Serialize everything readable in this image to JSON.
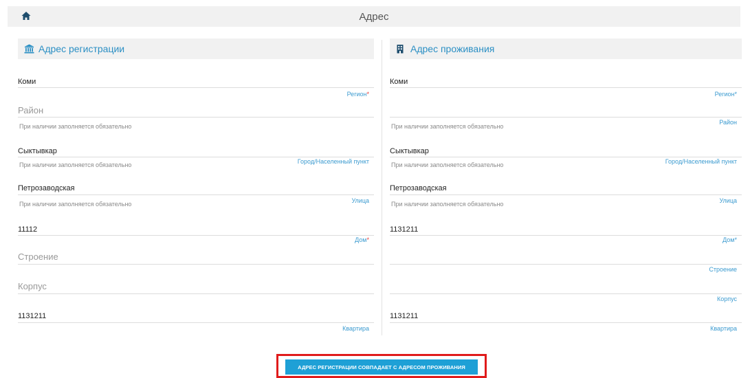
{
  "header": {
    "title": "Адрес"
  },
  "registration": {
    "title": "Адрес регистрации",
    "region": {
      "value": "Коми",
      "label": "Регион",
      "required": "*"
    },
    "district": {
      "placeholder": "Район",
      "hint": "При наличии заполняется обязательно"
    },
    "city": {
      "value": "Сыктывкар",
      "label": "Город/Населенный пункт",
      "hint": "При наличии заполняется обязательно"
    },
    "street": {
      "value": "Петрозаводская",
      "label": "Улица",
      "hint": "При наличии заполняется обязательно"
    },
    "house": {
      "value": "11112",
      "label": "Дом",
      "required": "*"
    },
    "building": {
      "placeholder": "Строение"
    },
    "block": {
      "placeholder": "Корпус"
    },
    "apartment": {
      "value": "1131211",
      "label": "Квартира"
    }
  },
  "residence": {
    "title": "Адрес проживания",
    "region": {
      "value": "Коми",
      "label": "Регион*"
    },
    "district": {
      "label": "Район",
      "hint": "При наличии заполняется обязательно"
    },
    "city": {
      "value": "Сыктывкар",
      "label": "Город/Населенный пункт",
      "hint": "При наличии заполняется обязательно"
    },
    "street": {
      "value": "Петрозаводская",
      "label": "Улица",
      "hint": "При наличии заполняется обязательно"
    },
    "house": {
      "value": "1131211",
      "label": "Дом*"
    },
    "building": {
      "label": "Строение"
    },
    "block": {
      "label": "Корпус"
    },
    "apartment": {
      "value": "1131211",
      "label": "Квартира"
    }
  },
  "actions": {
    "match_button": "АДРЕС РЕГИСТРАЦИИ СОВПАДАЕТ С АДРЕСОМ ПРОЖИВАНИЯ"
  },
  "colors": {
    "accent": "#1ea0d6",
    "link": "#3c9bd0",
    "required": "#e53935",
    "highlight": "#e01b1b",
    "header_bg": "#f1f1f1"
  },
  "icons": {
    "home": "home-icon",
    "registration": "bank-building-icon",
    "residence": "building-icon"
  }
}
